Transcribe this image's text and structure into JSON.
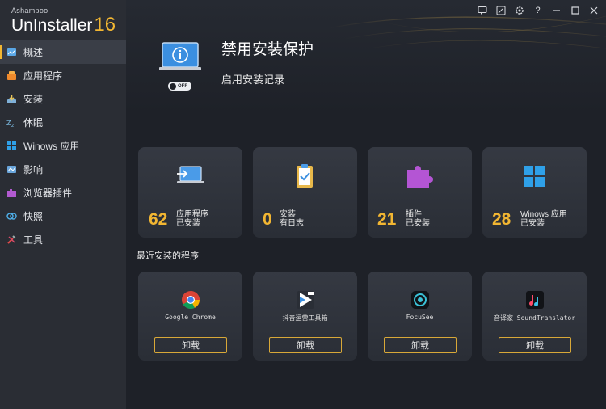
{
  "brand": {
    "small": "Ashampoo",
    "name": "UnInstaller",
    "version": "16"
  },
  "titlebar": {
    "icons": [
      "feedback-icon",
      "edit-icon",
      "settings-icon",
      "help-icon",
      "minimize-icon",
      "maximize-icon",
      "close-icon"
    ],
    "help_label": "?"
  },
  "sidebar": {
    "items": [
      {
        "label": "概述",
        "icon": "overview-icon",
        "active": true
      },
      {
        "label": "应用程序",
        "icon": "applications-icon"
      },
      {
        "label": "安装",
        "icon": "install-icon"
      },
      {
        "label": "休眠",
        "icon": "sleep-icon"
      },
      {
        "label": "Winows 应用",
        "icon": "windows-icon"
      },
      {
        "label": "影响",
        "icon": "impact-icon"
      },
      {
        "label": "浏览器插件",
        "icon": "browser-plugin-icon"
      },
      {
        "label": "快照",
        "icon": "snapshot-icon"
      },
      {
        "label": "工具",
        "icon": "tools-icon"
      }
    ]
  },
  "hero": {
    "title": "禁用安装保护",
    "subtitle": "启用安装记录",
    "toggle_label": "OFF"
  },
  "stats": [
    {
      "value": "62",
      "line1": "应用程序",
      "line2": "已安装",
      "icon": "laptop-icon"
    },
    {
      "value": "0",
      "line1": "安装",
      "line2": "有日志",
      "icon": "clipboard-icon"
    },
    {
      "value": "21",
      "line1": "插件",
      "line2": "已安装",
      "icon": "puzzle-icon"
    },
    {
      "value": "28",
      "line1": "Winows 应用",
      "line2": "已安装",
      "icon": "windows-icon"
    }
  ],
  "recent": {
    "title": "最近安装的程序",
    "apps": [
      {
        "name": "Google Chrome",
        "button": "卸载",
        "icon": "chrome-icon"
      },
      {
        "name": "抖音运营工具箱",
        "button": "卸载",
        "icon": "video-tool-icon"
      },
      {
        "name": "FocuSee",
        "button": "卸载",
        "icon": "focusee-icon"
      },
      {
        "name": "音译家 SoundTranslator",
        "button": "卸载",
        "icon": "music-note-icon"
      }
    ]
  },
  "colors": {
    "accent": "#f2b632",
    "sidebar_bg": "#2a2d34",
    "main_bg": "#1e2128",
    "card_bg": "#30343c"
  }
}
